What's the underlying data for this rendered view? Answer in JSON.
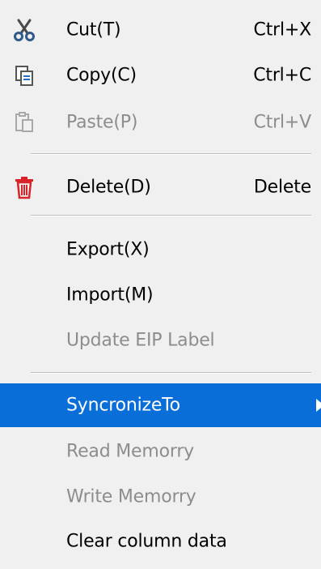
{
  "menu": {
    "items": [
      {
        "label": "Cut(T)",
        "shortcut": "Ctrl+X",
        "icon": "scissors-icon",
        "enabled": true
      },
      {
        "label": "Copy(C)",
        "shortcut": "Ctrl+C",
        "icon": "copy-icon",
        "enabled": true
      },
      {
        "label": "Paste(P)",
        "shortcut": "Ctrl+V",
        "icon": "paste-icon",
        "enabled": false
      },
      {
        "label": "Delete(D)",
        "shortcut": "Delete",
        "icon": "trash-icon",
        "enabled": true
      },
      {
        "label": "Export(X)",
        "enabled": true
      },
      {
        "label": "Import(M)",
        "enabled": true
      },
      {
        "label": "Update EIP Label",
        "enabled": false
      },
      {
        "label": "SyncronizeTo",
        "enabled": true,
        "highlighted": true,
        "submenu": true
      },
      {
        "label": "Read Memorry",
        "enabled": false
      },
      {
        "label": "Write Memorry",
        "enabled": false
      },
      {
        "label": "Clear column data",
        "enabled": true
      }
    ],
    "colors": {
      "background": "#f0f0f0",
      "highlight": "#0a6ed8",
      "disabled_text": "#8d8d8d",
      "delete_icon": "#d9232b",
      "scissors_icon": "#2f5a8a"
    }
  }
}
